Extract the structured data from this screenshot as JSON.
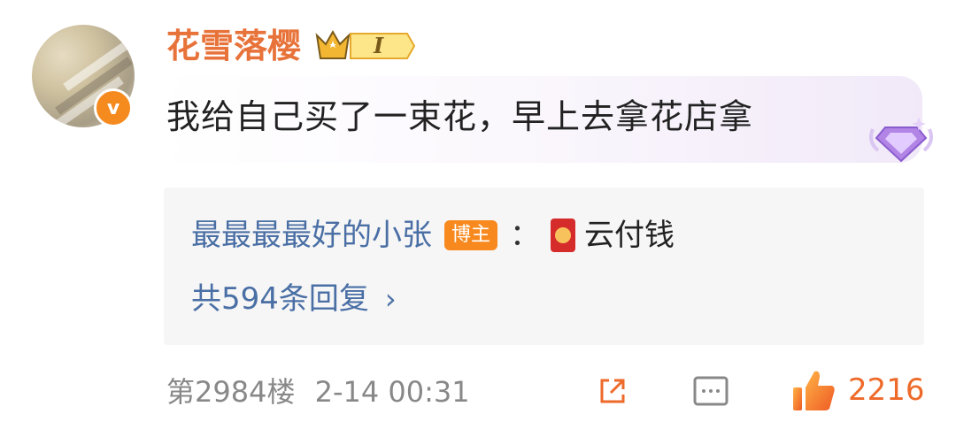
{
  "comment": {
    "username": "花雪落樱",
    "level_badge": "I",
    "text": "我给自己买了一束花，早上去拿花店拿",
    "floor": "第2984楼",
    "time": "2-14 00:31",
    "likes": "2216"
  },
  "reply": {
    "user": "最最最最好的小张",
    "author_tag": "博主",
    "colon": "：",
    "text": "云付钱",
    "count_label": "共594条回复",
    "chevron": "›"
  },
  "avatar": {
    "badge": "v"
  },
  "icons": {
    "crown": "crown-icon",
    "diamond": "diamond-badge-icon",
    "share": "share-icon",
    "comment": "comment-icon",
    "like": "thumbs-up-icon",
    "redpacket": "red-packet-icon"
  },
  "colors": {
    "username": "#e8733a",
    "link": "#4a6fa5",
    "tag": "#f7891e",
    "like": "#ee6a2a"
  }
}
